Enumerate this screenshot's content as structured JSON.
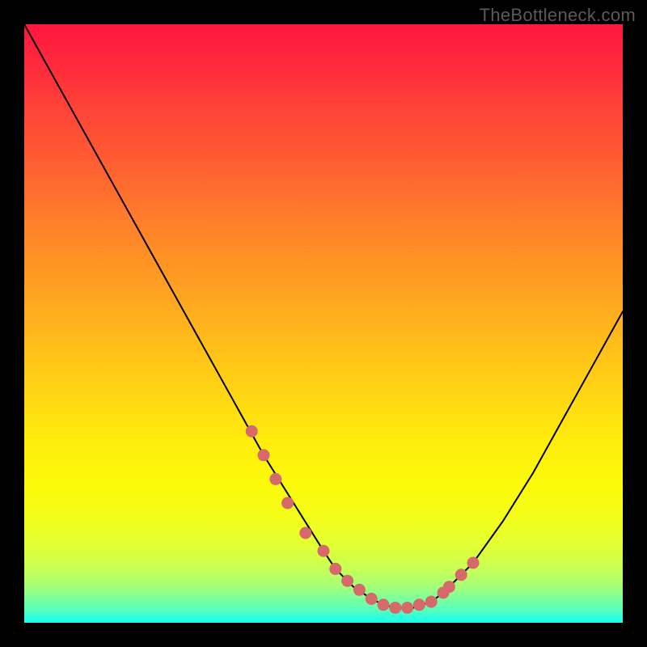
{
  "watermark": "TheBottleneck.com",
  "chart_data": {
    "type": "line",
    "title": "",
    "xlabel": "",
    "ylabel": "",
    "xlim": [
      0,
      100
    ],
    "ylim": [
      0,
      100
    ],
    "grid": false,
    "legend": false,
    "series": [
      {
        "name": "curve",
        "x": [
          0,
          5,
          10,
          15,
          20,
          25,
          30,
          35,
          40,
          45,
          50,
          52,
          55,
          58,
          60,
          62,
          65,
          68,
          70,
          75,
          80,
          85,
          90,
          95,
          100
        ],
        "y": [
          100,
          91,
          82,
          73,
          64,
          55,
          46,
          37,
          28,
          20,
          12,
          9,
          6,
          4,
          3,
          2.5,
          2.5,
          3.5,
          5,
          10,
          17,
          25,
          34,
          43,
          52
        ]
      }
    ],
    "markers": {
      "name": "highlight-points",
      "x": [
        38,
        40,
        42,
        44,
        47,
        50,
        52,
        54,
        56,
        58,
        60,
        62,
        64,
        66,
        68,
        70,
        71,
        73,
        75
      ],
      "y": [
        32,
        28,
        24,
        20,
        15,
        12,
        9,
        7,
        5.5,
        4,
        3,
        2.5,
        2.5,
        3,
        3.5,
        5,
        6,
        8,
        10
      ]
    },
    "background_gradient": {
      "top_color": "#ff173f",
      "mid_color": "#ffd912",
      "bottom_color": "#18ffee"
    }
  }
}
